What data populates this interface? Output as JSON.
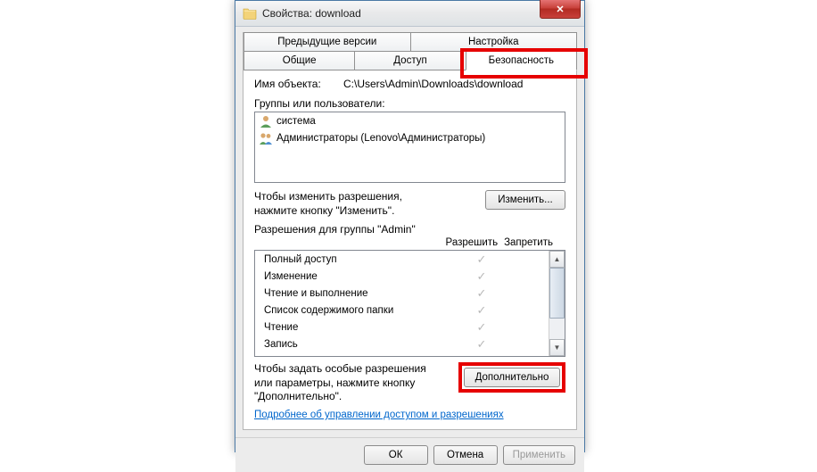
{
  "window": {
    "title": "Свойства: download"
  },
  "tabs": {
    "row1": [
      "Предыдущие версии",
      "Настройка"
    ],
    "row2": [
      "Общие",
      "Доступ",
      "Безопасность"
    ],
    "active": "Безопасность"
  },
  "object": {
    "label": "Имя объекта:",
    "path": "C:\\Users\\Admin\\Downloads\\download"
  },
  "groups": {
    "label": "Группы или пользователи:",
    "items": [
      {
        "name": "система",
        "icon": "user-single"
      },
      {
        "name": "Администраторы (Lenovo\\Администраторы)",
        "icon": "user-multi"
      }
    ]
  },
  "editHint": {
    "text": "Чтобы изменить разрешения, нажмите кнопку \"Изменить\".",
    "button": "Изменить..."
  },
  "permissions": {
    "label": "Разрешения для группы \"Admin\"",
    "allow": "Разрешить",
    "deny": "Запретить",
    "rows": [
      {
        "name": "Полный доступ",
        "allow": true,
        "deny": false
      },
      {
        "name": "Изменение",
        "allow": true,
        "deny": false
      },
      {
        "name": "Чтение и выполнение",
        "allow": true,
        "deny": false
      },
      {
        "name": "Список содержимого папки",
        "allow": true,
        "deny": false
      },
      {
        "name": "Чтение",
        "allow": true,
        "deny": false
      },
      {
        "name": "Запись",
        "allow": true,
        "deny": false
      }
    ]
  },
  "advanced": {
    "text": "Чтобы задать особые разрешения или параметры, нажмите кнопку \"Дополнительно\".",
    "button": "Дополнительно"
  },
  "link": "Подробнее об управлении доступом и разрешениях",
  "footer": {
    "ok": "ОК",
    "cancel": "Отмена",
    "apply": "Применить"
  }
}
